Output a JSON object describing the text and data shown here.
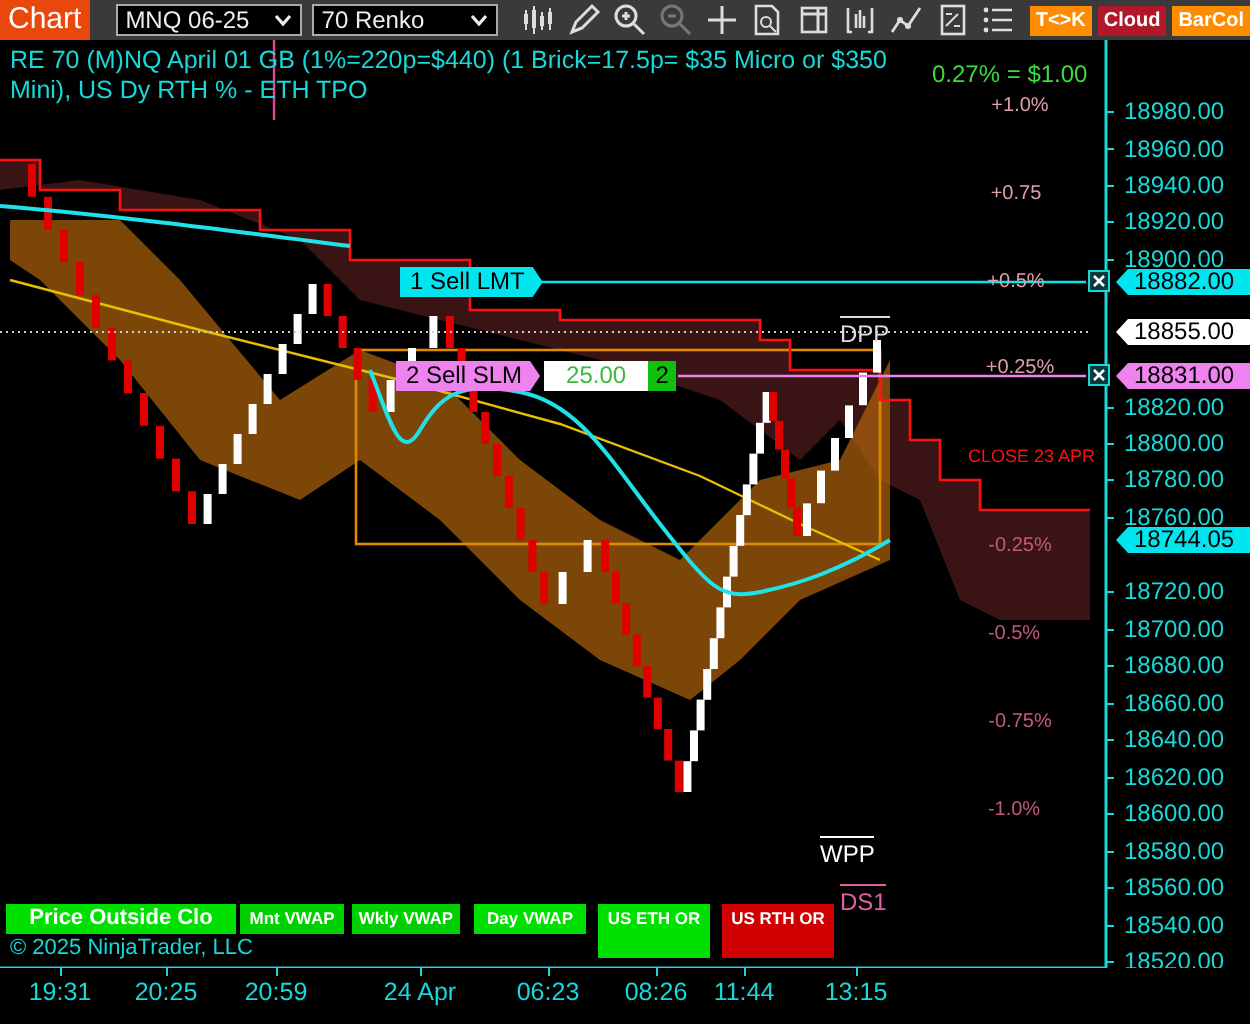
{
  "toolbar": {
    "tab": "Chart",
    "instrument": "MNQ 06-25",
    "bar_type": "70 Renko",
    "toggles": [
      {
        "label": "T<>K",
        "color": "#ff8c00"
      },
      {
        "label": "Cloud",
        "color": "#b0182a"
      },
      {
        "label": "BarCol",
        "color": "#ff8c00"
      }
    ]
  },
  "chart": {
    "title": "RE 70 (M)NQ April 01 GB (1%=220p=$440) (1 Brick=17.5p= $35 Micro or $350 Mini), US Dy RTH % - ETH TPO",
    "pnl": "0.27% = $1.00",
    "price_axis": [
      "18980.00",
      "18960.00",
      "18940.00",
      "18920.00",
      "18900.00",
      "18820.00",
      "18800.00",
      "18780.00",
      "18760.00",
      "18720.00",
      "18700.00",
      "18680.00",
      "18660.00",
      "18640.00",
      "18620.00",
      "18600.00",
      "18580.00",
      "18560.00",
      "18540.00",
      "18520.00"
    ],
    "price_markers": [
      {
        "label": "18882.00",
        "color": "#00e5ee"
      },
      {
        "label": "18855.00",
        "color": "#ffffff"
      },
      {
        "label": "18831.00",
        "color": "#ee82ee"
      },
      {
        "label": "18744.05",
        "color": "#00e5ee"
      }
    ],
    "levels": [
      {
        "label": "+1.0%",
        "color": "#e0a0a8"
      },
      {
        "label": "+0.75",
        "color": "#e0a0a8"
      },
      {
        "label": "+0.5%",
        "color": "#e0a0a8"
      },
      {
        "label": "+0.25%",
        "color": "#e0a0a8"
      },
      {
        "label": "CLOSE 23 APR",
        "color": "#ff1010"
      },
      {
        "label": "-0.25%",
        "color": "#c05a80"
      },
      {
        "label": "-0.5%",
        "color": "#c05a80"
      },
      {
        "label": "-0.75%",
        "color": "#c05a80"
      },
      {
        "label": "-1.0%",
        "color": "#c05a80"
      }
    ],
    "orders": [
      {
        "label": "1 Sell LMT",
        "color": "#00e5ee"
      },
      {
        "label": "2 Sell SLM",
        "color": "#ee82ee",
        "price": "25.00",
        "quantity": "2"
      }
    ],
    "pivots": [
      {
        "label": "DPP",
        "color": "#dddddd"
      },
      {
        "label": "WPP",
        "color": "#ffffff"
      },
      {
        "label": "DS1",
        "color": "#e060a0"
      }
    ],
    "indicators": [
      {
        "label": "Price Outside Clo",
        "color": "#00e000"
      },
      {
        "label": "Mnt VWAP",
        "color": "#00d000"
      },
      {
        "label": "Wkly VWAP",
        "color": "#00d000"
      },
      {
        "label": "Day VWAP",
        "color": "#00e000"
      },
      {
        "label": "US ETH OR",
        "color": "#00e000"
      },
      {
        "label": "US RTH OR",
        "color": "#d00000"
      }
    ],
    "copyright": "© 2025 NinjaTrader, LLC"
  },
  "time_axis": [
    "19:31",
    "20:25",
    "20:59",
    "24 Apr",
    "06:23",
    "08:26",
    "11:44",
    "13:15"
  ]
}
